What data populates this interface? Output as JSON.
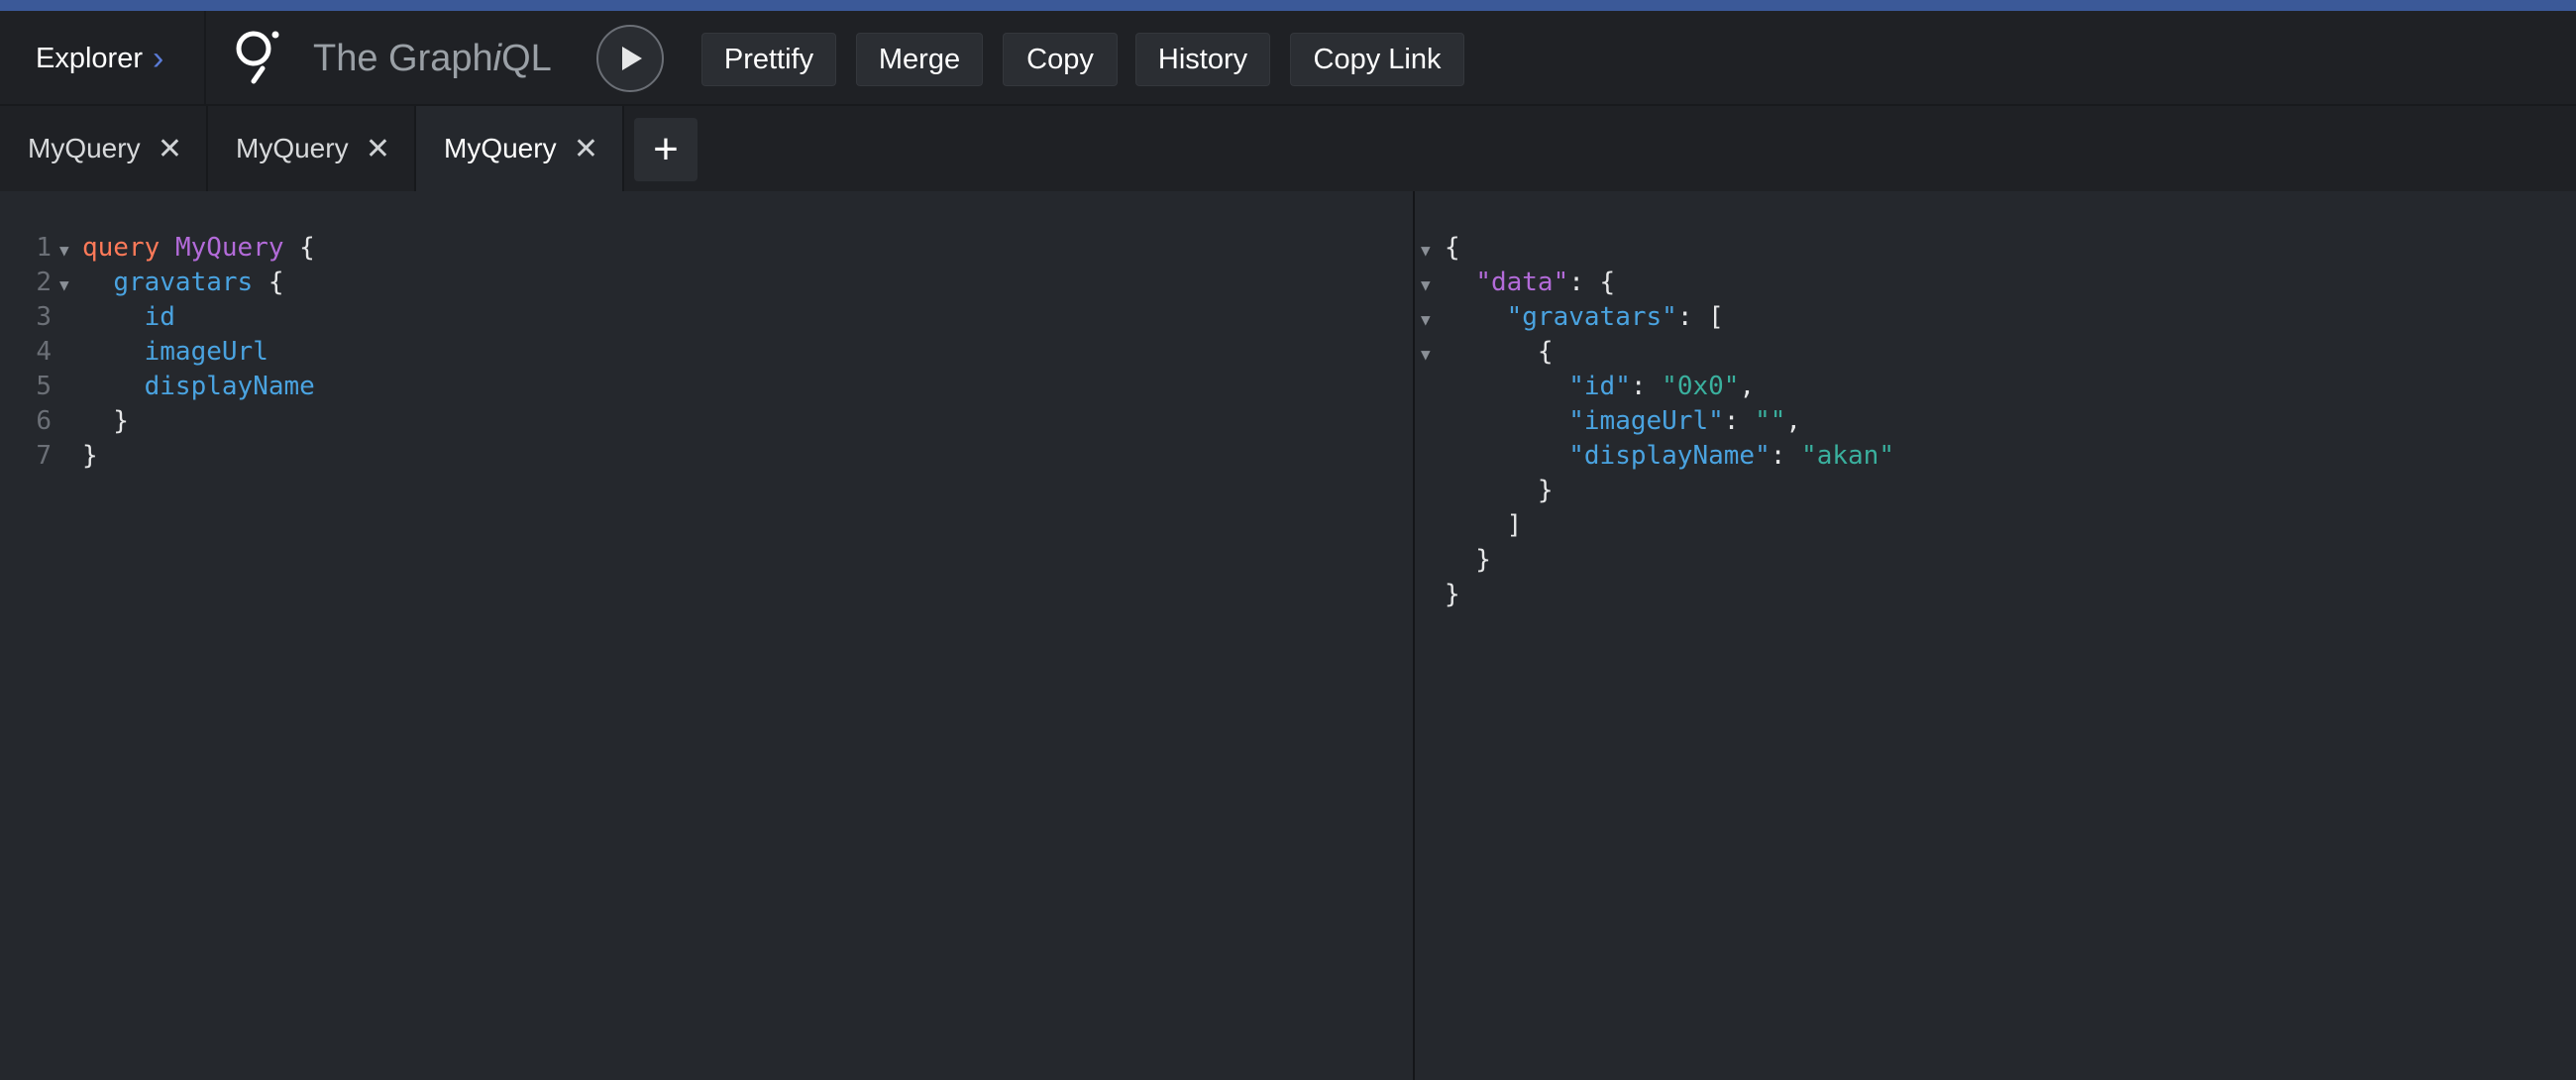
{
  "toolbar": {
    "explorer_label": "Explorer",
    "app_title_pre": "The Graph",
    "app_title_i": "i",
    "app_title_post": "QL",
    "buttons": [
      "Prettify",
      "Merge",
      "Copy",
      "History",
      "Copy Link"
    ]
  },
  "tabs": [
    {
      "label": "MyQuery",
      "active": false
    },
    {
      "label": "MyQuery",
      "active": false
    },
    {
      "label": "MyQuery",
      "active": true
    }
  ],
  "editor": {
    "line_numbers": [
      "1",
      "2",
      "3",
      "4",
      "5",
      "6",
      "7"
    ],
    "lines": [
      {
        "parts": [
          {
            "t": "query",
            "c": "kw"
          },
          {
            "t": " ",
            "c": "punct"
          },
          {
            "t": "MyQuery",
            "c": "opname"
          },
          {
            "t": " {",
            "c": "punct"
          }
        ]
      },
      {
        "parts": [
          {
            "t": "  ",
            "c": "punct"
          },
          {
            "t": "gravatars",
            "c": "field"
          },
          {
            "t": " {",
            "c": "punct"
          }
        ]
      },
      {
        "parts": [
          {
            "t": "    ",
            "c": "punct"
          },
          {
            "t": "id",
            "c": "field"
          }
        ]
      },
      {
        "parts": [
          {
            "t": "    ",
            "c": "punct"
          },
          {
            "t": "imageUrl",
            "c": "field"
          }
        ]
      },
      {
        "parts": [
          {
            "t": "    ",
            "c": "punct"
          },
          {
            "t": "displayName",
            "c": "field"
          }
        ]
      },
      {
        "parts": [
          {
            "t": "  }",
            "c": "punct"
          }
        ]
      },
      {
        "parts": [
          {
            "t": "}",
            "c": "punct"
          }
        ]
      }
    ]
  },
  "result": {
    "lines": [
      {
        "parts": [
          {
            "t": "{",
            "c": "punct"
          }
        ]
      },
      {
        "parts": [
          {
            "t": "  ",
            "c": "punct"
          },
          {
            "t": "\"data\"",
            "c": "jkey-data"
          },
          {
            "t": ": {",
            "c": "punct"
          }
        ]
      },
      {
        "parts": [
          {
            "t": "    ",
            "c": "punct"
          },
          {
            "t": "\"gravatars\"",
            "c": "jkey"
          },
          {
            "t": ": [",
            "c": "punct"
          }
        ]
      },
      {
        "parts": [
          {
            "t": "      {",
            "c": "punct"
          }
        ]
      },
      {
        "parts": [
          {
            "t": "        ",
            "c": "punct"
          },
          {
            "t": "\"id\"",
            "c": "jkey"
          },
          {
            "t": ": ",
            "c": "punct"
          },
          {
            "t": "\"0x0\"",
            "c": "jstr"
          },
          {
            "t": ",",
            "c": "punct"
          }
        ]
      },
      {
        "parts": [
          {
            "t": "        ",
            "c": "punct"
          },
          {
            "t": "\"imageUrl\"",
            "c": "jkey"
          },
          {
            "t": ": ",
            "c": "punct"
          },
          {
            "t": "\"\"",
            "c": "jstr"
          },
          {
            "t": ",",
            "c": "punct"
          }
        ]
      },
      {
        "parts": [
          {
            "t": "        ",
            "c": "punct"
          },
          {
            "t": "\"displayName\"",
            "c": "jkey"
          },
          {
            "t": ": ",
            "c": "punct"
          },
          {
            "t": "\"akan\"",
            "c": "jstr"
          }
        ]
      },
      {
        "parts": [
          {
            "t": "      }",
            "c": "punct"
          }
        ]
      },
      {
        "parts": [
          {
            "t": "    ]",
            "c": "punct"
          }
        ]
      },
      {
        "parts": [
          {
            "t": "  }",
            "c": "punct"
          }
        ]
      },
      {
        "parts": [
          {
            "t": "}",
            "c": "punct"
          }
        ]
      }
    ]
  },
  "colors": {
    "accent": "#3b5998",
    "keyword": "#ff7a59",
    "operation": "#b36bd9",
    "field": "#4aa3e0",
    "string": "#3ab09e"
  },
  "icons": [
    "chevron-right-icon",
    "graph-logo-icon",
    "play-icon",
    "close-icon",
    "plus-icon",
    "fold-arrow-icon"
  ]
}
